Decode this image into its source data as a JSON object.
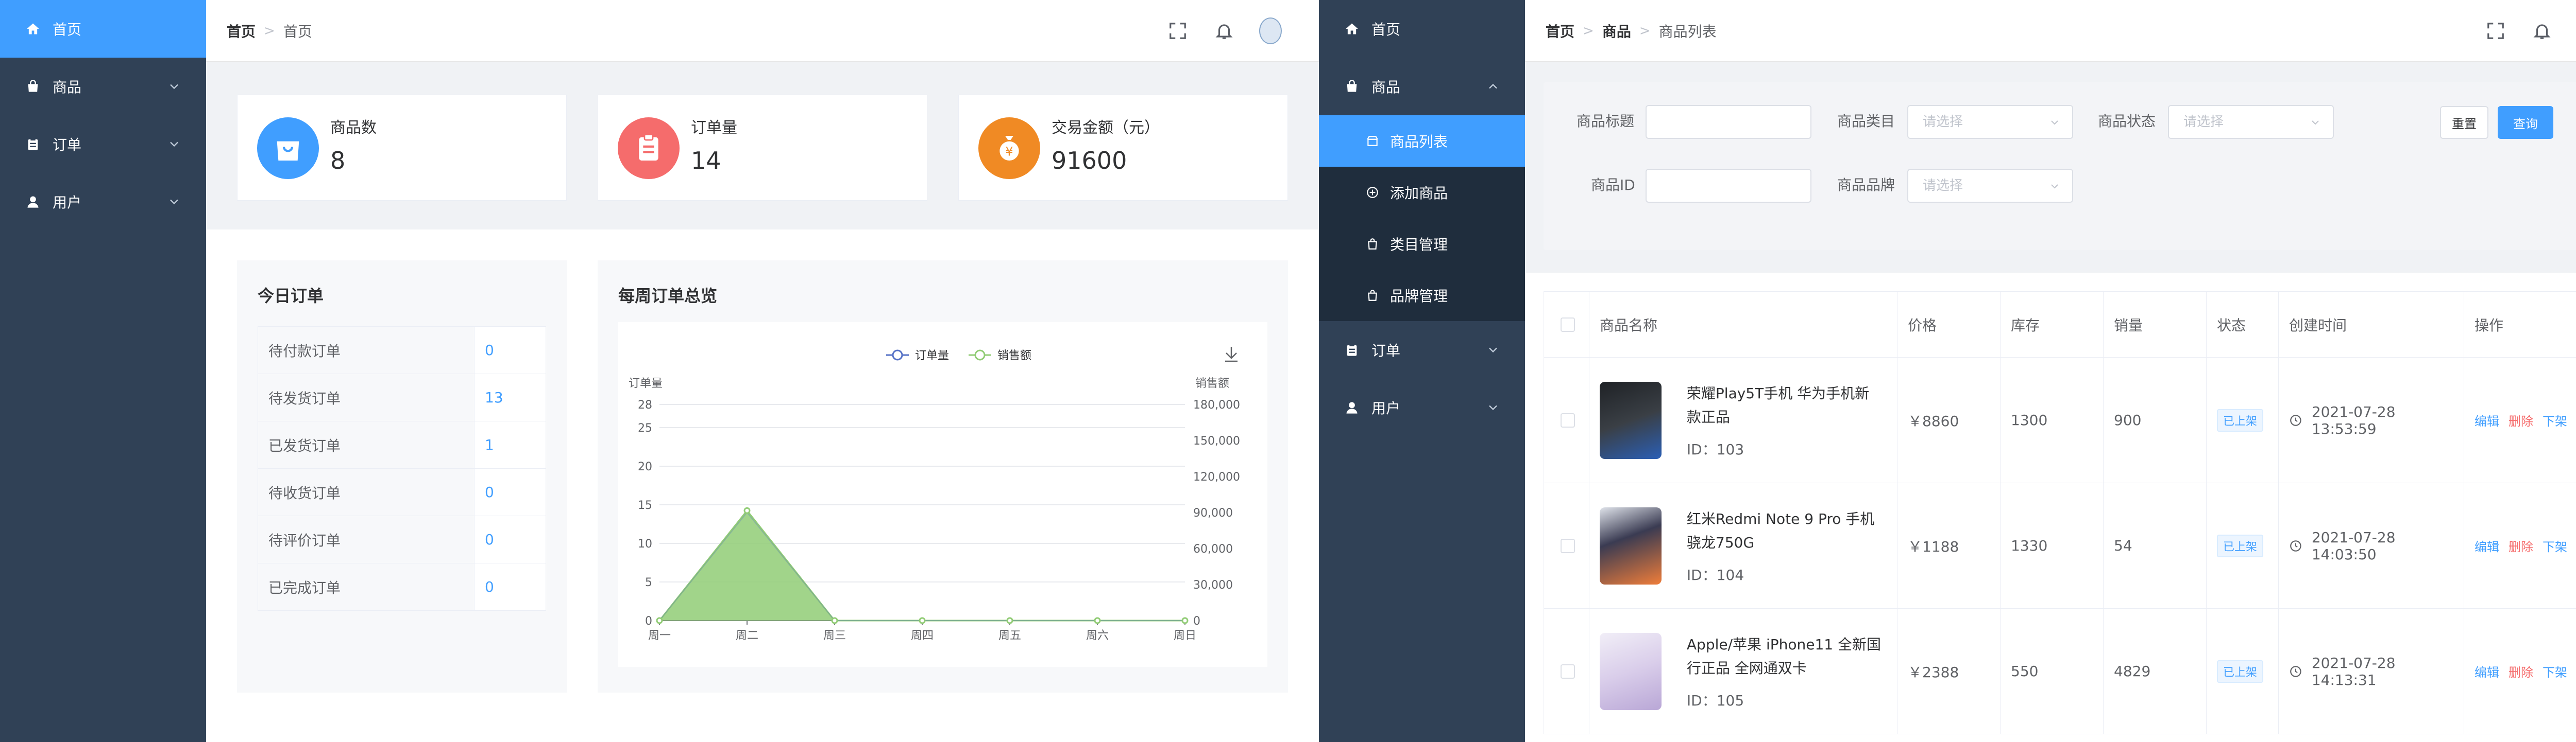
{
  "left_screen": {
    "sidebar": {
      "items": [
        {
          "label": "首页",
          "icon": "home-icon",
          "active": true
        },
        {
          "label": "商品",
          "icon": "bag-icon"
        },
        {
          "label": "订单",
          "icon": "clipboard-icon"
        },
        {
          "label": "用户",
          "icon": "user-icon"
        }
      ]
    },
    "header": {
      "breadcrumb": [
        "首页",
        "首页"
      ]
    },
    "stats": [
      {
        "label": "商品数",
        "value": "8",
        "color": "#409eff",
        "icon": "bag-icon"
      },
      {
        "label": "订单量",
        "value": "14",
        "color": "#f56c6c",
        "icon": "clipboard-icon"
      },
      {
        "label": "交易金额（元）",
        "value": "91600",
        "color": "#f08a24",
        "icon": "money-bag-icon"
      }
    ],
    "today_orders": {
      "title": "今日订单",
      "rows": [
        {
          "label": "待付款订单",
          "value": "0"
        },
        {
          "label": "待发货订单",
          "value": "13"
        },
        {
          "label": "已发货订单",
          "value": "1"
        },
        {
          "label": "待收货订单",
          "value": "0"
        },
        {
          "label": "待评价订单",
          "value": "0"
        },
        {
          "label": "已完成订单",
          "value": "0"
        }
      ]
    },
    "weekly": {
      "title": "每周订单总览"
    }
  },
  "chart_data": {
    "type": "area",
    "categories": [
      "周一",
      "周二",
      "周三",
      "周四",
      "周五",
      "周六",
      "周日"
    ],
    "series": [
      {
        "name": "订单量",
        "values": [
          0,
          14,
          0,
          0,
          0,
          0,
          0
        ],
        "axis": "left",
        "color": "#5470c6"
      },
      {
        "name": "销售额",
        "values": [
          0,
          91600,
          0,
          0,
          0,
          0,
          0
        ],
        "axis": "right",
        "color": "#91cc75"
      }
    ],
    "ylabel": "订单量",
    "ylabel_right": "销售额",
    "ylim": [
      0,
      28
    ],
    "yticks": [
      "0",
      "5",
      "10",
      "15",
      "20",
      "25",
      "28"
    ],
    "ylim_right": [
      0,
      180000
    ],
    "yticks_right": [
      "0",
      "30,000",
      "60,000",
      "90,000",
      "120,000",
      "150,000",
      "180,000"
    ],
    "legend": "top-center",
    "grid": true
  },
  "right_screen": {
    "sidebar": {
      "items": [
        {
          "label": "首页",
          "icon": "home-icon"
        },
        {
          "label": "商品",
          "icon": "bag-icon",
          "expanded": true
        },
        {
          "label": "订单",
          "icon": "clipboard-icon"
        },
        {
          "label": "用户",
          "icon": "user-icon"
        }
      ],
      "sub_items": [
        {
          "label": "商品列表",
          "icon": "shop-icon",
          "active": true
        },
        {
          "label": "添加商品",
          "icon": "plus-circle-icon"
        },
        {
          "label": "类目管理",
          "icon": "bag-icon"
        },
        {
          "label": "品牌管理",
          "icon": "bag-icon"
        }
      ]
    },
    "header": {
      "breadcrumb": [
        "首页",
        "商品",
        "商品列表"
      ]
    },
    "filters": {
      "title_label": "商品标题",
      "category_label": "商品类目",
      "category_placeholder": "请选择",
      "status_label": "商品状态",
      "status_placeholder": "请选择",
      "id_label": "商品ID",
      "brand_label": "商品品牌",
      "brand_placeholder": "请选择",
      "reset": "重置",
      "search": "查询"
    },
    "table": {
      "columns": [
        "商品名称",
        "价格",
        "库存",
        "销量",
        "状态",
        "创建时间",
        "操作"
      ],
      "rows": [
        {
          "name": "荣耀Play5T手机 华为手机新款正品",
          "id": "ID：103",
          "price": "￥8860",
          "stock": "1300",
          "sales": "900",
          "status": "已上架",
          "created": "2021-07-28 13:53:59"
        },
        {
          "name": "红米Redmi Note 9 Pro 手机 骁龙750G",
          "id": "ID：104",
          "price": "￥1188",
          "stock": "1330",
          "sales": "54",
          "status": "已上架",
          "created": "2021-07-28 14:03:50"
        },
        {
          "name": "Apple/苹果 iPhone11 全新国行正品 全网通双卡",
          "id": "ID：105",
          "price": "￥2388",
          "stock": "550",
          "sales": "4829",
          "status": "已上架",
          "created": "2021-07-28 14:13:31"
        }
      ],
      "actions": {
        "edit": "编辑",
        "delete": "删除",
        "offline": "下架"
      }
    }
  }
}
